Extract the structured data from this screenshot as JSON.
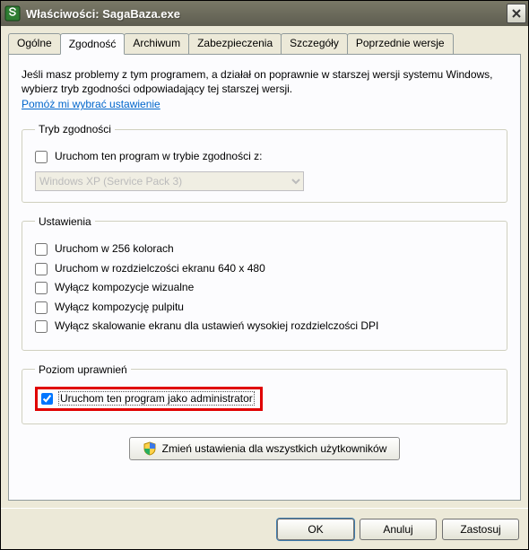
{
  "window": {
    "title": "Właściwości: SagaBaza.exe"
  },
  "tabs": {
    "general": "Ogólne",
    "compat": "Zgodność",
    "archive": "Archiwum",
    "security": "Zabezpieczenia",
    "details": "Szczegóły",
    "prev": "Poprzednie wersje"
  },
  "compat": {
    "intro": "Jeśli masz problemy z tym programem, a działał on poprawnie w starszej wersji systemu Windows, wybierz tryb zgodności odpowiadający tej starszej wersji.",
    "help_link": "Pomóż mi wybrać ustawienie",
    "mode_legend": "Tryb zgodności",
    "mode_check": "Uruchom ten program w trybie zgodności z:",
    "mode_select": "Windows XP (Service Pack 3)",
    "settings_legend": "Ustawienia",
    "colors256": "Uruchom w 256 kolorach",
    "res640": "Uruchom w rozdzielczości ekranu 640 x 480",
    "disable_visual": "Wyłącz kompozycje wizualne",
    "disable_desktop": "Wyłącz kompozycję pulpitu",
    "disable_dpi": "Wyłącz skalowanie ekranu dla ustawień wysokiej rozdzielczości DPI",
    "priv_legend": "Poziom uprawnień",
    "run_admin": "Uruchom ten program jako administrator",
    "all_users_btn": "Zmień ustawienia dla wszystkich użytkowników"
  },
  "buttons": {
    "ok": "OK",
    "cancel": "Anuluj",
    "apply": "Zastosuj"
  }
}
